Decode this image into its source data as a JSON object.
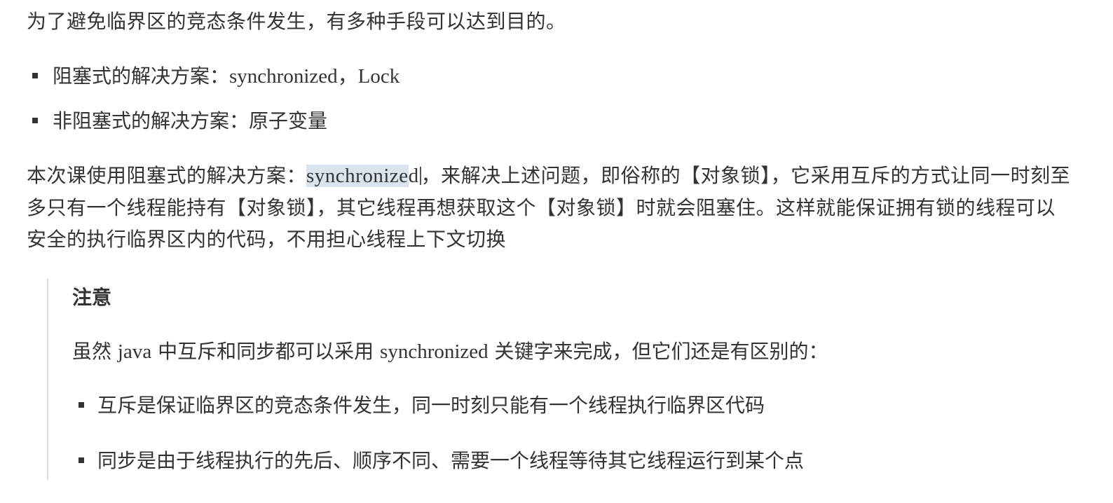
{
  "intro": "为了避免临界区的竞态条件发生，有多种手段可以达到目的。",
  "bullets": [
    {
      "prefix": "阻塞式的解决方案：",
      "latin": "synchronized，Lock"
    },
    {
      "prefix": "非阻塞式的解决方案：原子变量",
      "latin": ""
    }
  ],
  "main": {
    "before": "本次课使用阻塞式的解决方案：",
    "highlighted": "synchronize",
    "highlighted_tail": "d",
    "after": "，来解决上述问题，即俗称的【对象锁】，它采用互斥的方式让同一时刻至多只有一个线程能持有【对象锁】，其它线程再想获取这个【对象锁】时就会阻塞住。这样就能保证拥有锁的线程可以安全的执行临界区内的代码，不用担心线程上下文切换"
  },
  "note": {
    "title": "注意",
    "text_a": "虽然 ",
    "text_java": "java",
    "text_b": " 中互斥和同步都可以采用 ",
    "text_sync": "synchronized",
    "text_c": " 关键字来完成，但它们还是有区别的：",
    "items": [
      "互斥是保证临界区的竞态条件发生，同一时刻只能有一个线程执行临界区代码",
      "同步是由于线程执行的先后、顺序不同、需要一个线程等待其它线程运行到某个点"
    ]
  }
}
